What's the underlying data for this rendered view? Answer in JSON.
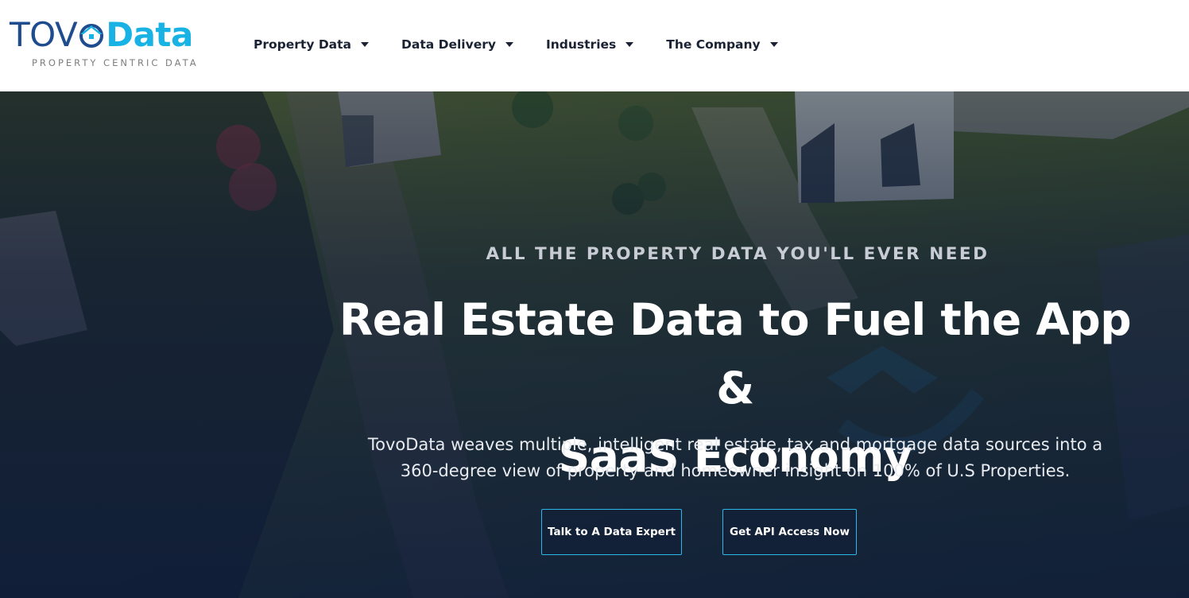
{
  "brand": {
    "logo_part1": "TOV",
    "logo_part2": "Data",
    "tagline": "PROPERTY CENTRIC DATA",
    "colors": {
      "navy": "#1f4b8f",
      "cyan": "#18b3e4"
    }
  },
  "nav": {
    "items": [
      {
        "label": "Property Data",
        "icon": "caret-down-icon"
      },
      {
        "label": "Data Delivery",
        "icon": "caret-down-icon"
      },
      {
        "label": "Industries",
        "icon": "caret-down-icon"
      },
      {
        "label": "The Company",
        "icon": "caret-down-icon"
      }
    ]
  },
  "hero": {
    "eyebrow": "ALL THE PROPERTY DATA YOU'LL EVER NEED",
    "headline_line1": "Real Estate Data to Fuel the App &",
    "headline_line2": "SaaS Economy",
    "subtext_line1": "TovoData weaves multiple, intelligent real estate, tax and mortgage data sources into a",
    "subtext_line2": "360-degree view of property and homeowner insight on 100% of U.S Properties.",
    "buttons": {
      "expert": "Talk to A Data Expert",
      "api": "Get API Access Now"
    },
    "accent_border": "#2ab8e8"
  }
}
